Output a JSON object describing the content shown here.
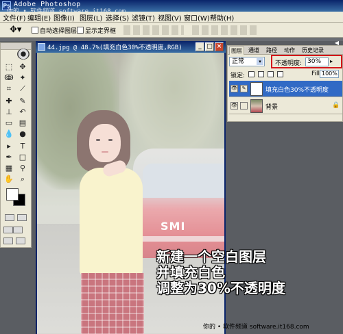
{
  "app": {
    "title": "Adobe Photoshop",
    "watermark_top": "你的 • 软件频道 software.it168.com",
    "watermark_bottom": "你的 • 软件频道 software.it168.com"
  },
  "menu": [
    "文件(F)",
    "编辑(E)",
    "图像(I)",
    "图层(L)",
    "选择(S)",
    "滤镜(T)",
    "视图(V)",
    "窗口(W)",
    "帮助(H)"
  ],
  "options": {
    "auto_select": "自动选择图层",
    "show_bounds": "显示定界框"
  },
  "document": {
    "title": "44.jpg @ 48.7%(填充白色30%不透明度,RGB)",
    "car_logo": "SMI"
  },
  "layers_panel": {
    "tabs": [
      "图层",
      "通道",
      "路径",
      "动作",
      "历史记录"
    ],
    "blend_mode": "正常",
    "opacity_label": "不透明度:",
    "opacity_value": "30%",
    "lock_label": "锁定:",
    "fill_label": "Fill:",
    "fill_value": "100%",
    "layers": [
      {
        "name": "填充白色30%不透明度",
        "selected": true
      },
      {
        "name": "背景",
        "selected": false
      }
    ]
  },
  "caption": {
    "line1": "新建一个空白图层",
    "line2": "并填充白色",
    "line3": "调整为30%不透明度"
  }
}
